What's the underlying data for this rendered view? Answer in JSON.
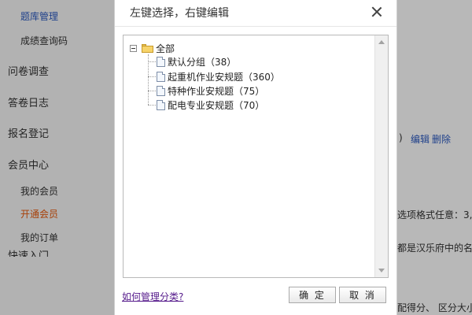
{
  "sidebar": {
    "items": [
      {
        "label": "题库管理",
        "style": "sub blue"
      },
      {
        "label": "成绩查询码",
        "style": "sub"
      },
      {
        "label": "问卷调查",
        "style": "top"
      },
      {
        "label": "答卷日志",
        "style": "top"
      },
      {
        "label": "报名登记",
        "style": "top"
      },
      {
        "label": "会员中心",
        "style": "top"
      },
      {
        "label": "我的会员",
        "style": "sub"
      },
      {
        "label": "开通会员",
        "style": "sub orange"
      },
      {
        "label": "我的订单",
        "style": "sub"
      },
      {
        "label": "快速入门",
        "style": "top"
      }
    ]
  },
  "background": {
    "row_suffix": ")",
    "edit_link": "编辑",
    "delete_link": "删除",
    "option_hint": "选项格式任意：3,",
    "sample_text": "都是汉乐府中的名",
    "score_text": "配得分、 区分大小"
  },
  "dialog": {
    "title": "左键选择，右键编辑",
    "tree": {
      "root_label": "全部",
      "children": [
        {
          "label": "默认分组（38）"
        },
        {
          "label": "起重机作业安规题（360）"
        },
        {
          "label": "特种作业安规题（75）"
        },
        {
          "label": "配电专业安规题（70）"
        }
      ]
    },
    "help_link": "如何管理分类?",
    "ok_label": "确 定",
    "cancel_label": "取 消"
  },
  "colors": {
    "link_blue": "#2b59c0",
    "active_orange": "#e8590c",
    "visited_link": "#551a8b",
    "folder_yellow": "#f7d46a"
  }
}
